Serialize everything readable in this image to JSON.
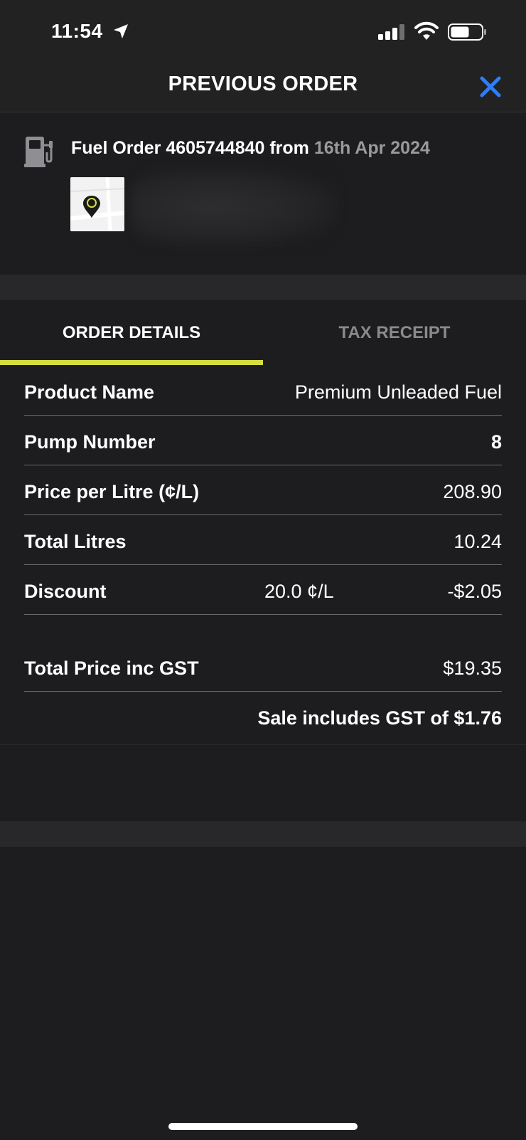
{
  "status_bar": {
    "time": "11:54"
  },
  "nav": {
    "title": "PREVIOUS ORDER",
    "close_icon": "close-icon"
  },
  "order": {
    "prefix": "Fuel Order 4605744840 from ",
    "date": "16th Apr 2024",
    "icon": "fuel-pump-icon"
  },
  "tabs": [
    {
      "label": "ORDER DETAILS",
      "active": true
    },
    {
      "label": "TAX RECEIPT",
      "active": false
    }
  ],
  "details": {
    "product_name_label": "Product Name",
    "product_name_value": "Premium Unleaded Fuel",
    "pump_number_label": "Pump Number",
    "pump_number_value": "8",
    "price_per_litre_label": "Price per Litre (¢/L)",
    "price_per_litre_value": "208.90",
    "total_litres_label": "Total Litres",
    "total_litres_value": "10.24",
    "discount_label": "Discount",
    "discount_rate": "20.0 ¢/L",
    "discount_value": "-$2.05",
    "total_price_label": "Total Price inc GST",
    "total_price_value": "$19.35",
    "gst_note": "Sale includes GST of $1.76"
  },
  "colors": {
    "accent_underline": "#d6df3f",
    "close_blue": "#2f7ef6",
    "background": "#1d1d1f"
  }
}
